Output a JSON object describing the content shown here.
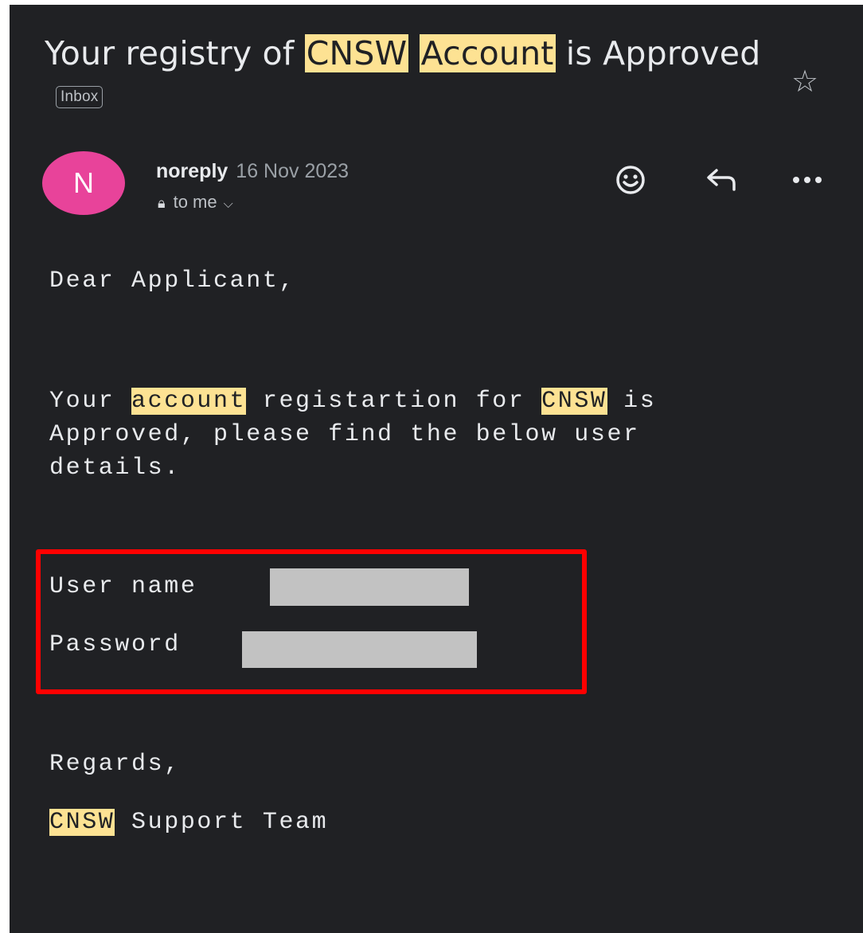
{
  "email": {
    "subject_parts": [
      "Your registry of ",
      "CNSW",
      " ",
      "Account",
      " is Approved"
    ],
    "label": "Inbox",
    "sender_initial": "N",
    "sender_name": "noreply",
    "date": "16 Nov 2023",
    "recipient": "to me",
    "body": {
      "greeting": "Dear Applicant,",
      "para_line1_parts": [
        "Your ",
        "account",
        " registartion for ",
        "CNSW",
        " is"
      ],
      "para_line2": "Approved, please find the below user",
      "para_line3": "details.",
      "username_label": "User name",
      "password_label": "Password",
      "closing": "Regards,",
      "signature_parts": [
        "CNSW",
        " Support Team"
      ]
    }
  },
  "colors": {
    "background": "#202124",
    "highlight": "#fde293",
    "avatar": "#e8439a",
    "annotation_box": "#ff0000",
    "redaction": "#c2c2c2"
  },
  "icons": {
    "star": "star-icon",
    "emoji": "emoji-reaction-icon",
    "reply": "reply-icon",
    "more": "more-options-icon",
    "security": "lock-icon",
    "expand": "chevron-down-icon"
  }
}
